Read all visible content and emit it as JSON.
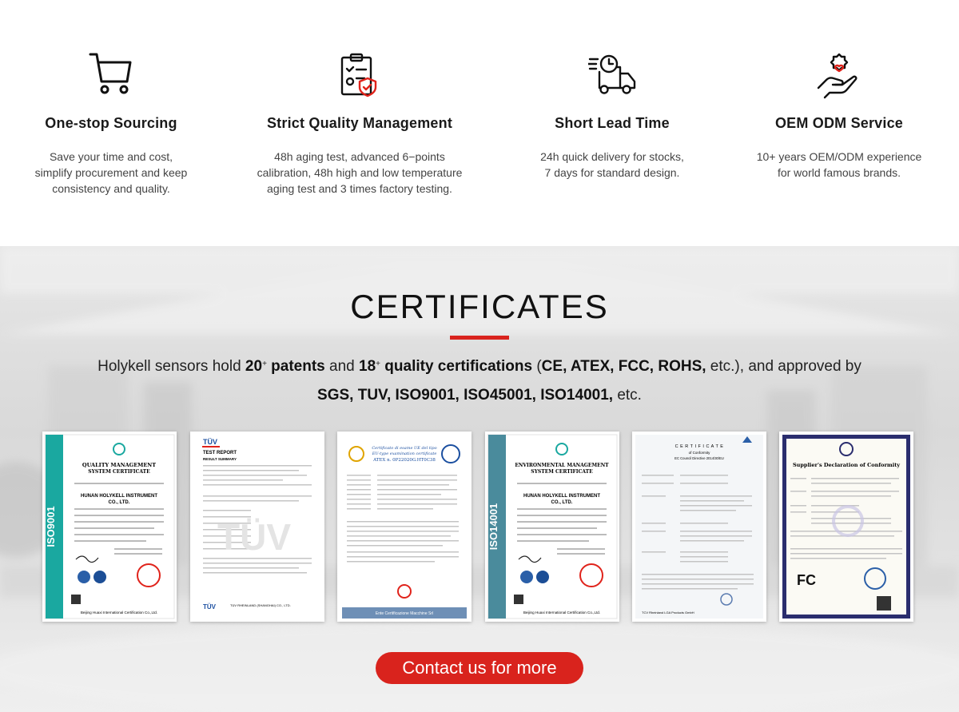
{
  "features": [
    {
      "icon": "shopping-cart-icon",
      "title": "One-stop Sourcing",
      "lines": [
        "Save your time and cost,",
        "simplify procurement and keep",
        "consistency and quality."
      ]
    },
    {
      "icon": "clipboard-check-icon",
      "title": "Strict Quality Management",
      "lines": [
        "48h aging test, advanced 6−points",
        "calibration, 48h high and low temperature",
        "aging test and 3 times factory testing."
      ]
    },
    {
      "icon": "delivery-truck-icon",
      "title": "Short Lead Time",
      "lines": [
        "24h quick delivery for stocks,",
        "7 days for standard design."
      ]
    },
    {
      "icon": "hand-gear-icon",
      "title": "OEM ODM Service",
      "lines": [
        "10+ years OEM/ODM experience",
        "for world famous brands."
      ]
    }
  ],
  "certificates": {
    "title": "CERTIFICATES",
    "desc": {
      "p1": "Holykell sensors hold ",
      "b1": "20",
      "s1": "+",
      "b1b": " patents",
      "p2": " and ",
      "b2": "18",
      "s2": "+",
      "b2b": " quality certifications",
      "p3": " (",
      "b3": "CE, ATEX, FCC, ROHS,",
      "p4": " etc.), and approved by",
      "b4": "SGS, TUV, ISO9001, ISO45001, ISO14001,",
      "p5": " etc."
    },
    "cards": [
      {
        "side_label": "ISO9001",
        "heading1": "QUALITY MANAGEMENT",
        "heading2": "SYSTEM CERTIFICATE",
        "company1": "HUNAN HOLYKELL INSTRUMENT",
        "company2": "CO., LTD.",
        "footer": "Beijing Huaxi International Certification Co.,Ltd."
      },
      {
        "logo": "TÜV",
        "heading1": "TEST REPORT",
        "heading2": "RESULT SUMMARY",
        "watermark": "TÜV",
        "footer": "TÜV RHEINLAND (SHANGHAI) CO., LTD."
      },
      {
        "heading1": "Certificato di esame UE del tipo",
        "heading2": "EU-type examination certificate",
        "heading3": "ATEX n. 0P22020G.HT0C38",
        "footer": "Ente Certificazione Macchine Srl"
      },
      {
        "side_label": "ISO14001",
        "heading1": "ENVIRONMENTAL MANAGEMENT",
        "heading2": "SYSTEM CERTIFICATE",
        "company1": "HUNAN HOLYKELL INSTRUMENT",
        "company2": "CO., LTD.",
        "footer": "Beijing Huaxi International Certification Co.,Ltd."
      },
      {
        "heading1": "C E R T I F I C A T E",
        "heading2": "of Conformity",
        "heading3": "EC Council Directive 2014/30/EU",
        "footer": "TCV Rheinland LGA Products GmbH"
      },
      {
        "heading1": "Supplier's Declaration of Conformity",
        "fc_logo": "FC"
      }
    ],
    "contact_label": "Contact us for more"
  },
  "colors": {
    "accent": "#d9231d",
    "iso9001_band": "#1aa8a0",
    "iso14001_band": "#4a8b9c"
  }
}
